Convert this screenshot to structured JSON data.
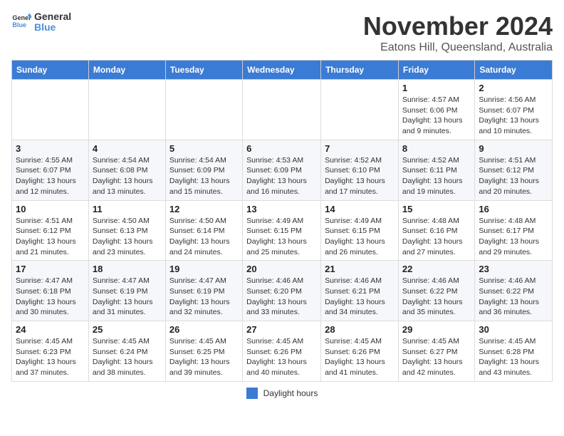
{
  "header": {
    "logo_line1": "General",
    "logo_line2": "Blue",
    "month": "November 2024",
    "location": "Eatons Hill, Queensland, Australia"
  },
  "days_of_week": [
    "Sunday",
    "Monday",
    "Tuesday",
    "Wednesday",
    "Thursday",
    "Friday",
    "Saturday"
  ],
  "weeks": [
    [
      {
        "day": "",
        "info": ""
      },
      {
        "day": "",
        "info": ""
      },
      {
        "day": "",
        "info": ""
      },
      {
        "day": "",
        "info": ""
      },
      {
        "day": "",
        "info": ""
      },
      {
        "day": "1",
        "info": "Sunrise: 4:57 AM\nSunset: 6:06 PM\nDaylight: 13 hours and 9 minutes."
      },
      {
        "day": "2",
        "info": "Sunrise: 4:56 AM\nSunset: 6:07 PM\nDaylight: 13 hours and 10 minutes."
      }
    ],
    [
      {
        "day": "3",
        "info": "Sunrise: 4:55 AM\nSunset: 6:07 PM\nDaylight: 13 hours and 12 minutes."
      },
      {
        "day": "4",
        "info": "Sunrise: 4:54 AM\nSunset: 6:08 PM\nDaylight: 13 hours and 13 minutes."
      },
      {
        "day": "5",
        "info": "Sunrise: 4:54 AM\nSunset: 6:09 PM\nDaylight: 13 hours and 15 minutes."
      },
      {
        "day": "6",
        "info": "Sunrise: 4:53 AM\nSunset: 6:09 PM\nDaylight: 13 hours and 16 minutes."
      },
      {
        "day": "7",
        "info": "Sunrise: 4:52 AM\nSunset: 6:10 PM\nDaylight: 13 hours and 17 minutes."
      },
      {
        "day": "8",
        "info": "Sunrise: 4:52 AM\nSunset: 6:11 PM\nDaylight: 13 hours and 19 minutes."
      },
      {
        "day": "9",
        "info": "Sunrise: 4:51 AM\nSunset: 6:12 PM\nDaylight: 13 hours and 20 minutes."
      }
    ],
    [
      {
        "day": "10",
        "info": "Sunrise: 4:51 AM\nSunset: 6:12 PM\nDaylight: 13 hours and 21 minutes."
      },
      {
        "day": "11",
        "info": "Sunrise: 4:50 AM\nSunset: 6:13 PM\nDaylight: 13 hours and 23 minutes."
      },
      {
        "day": "12",
        "info": "Sunrise: 4:50 AM\nSunset: 6:14 PM\nDaylight: 13 hours and 24 minutes."
      },
      {
        "day": "13",
        "info": "Sunrise: 4:49 AM\nSunset: 6:15 PM\nDaylight: 13 hours and 25 minutes."
      },
      {
        "day": "14",
        "info": "Sunrise: 4:49 AM\nSunset: 6:15 PM\nDaylight: 13 hours and 26 minutes."
      },
      {
        "day": "15",
        "info": "Sunrise: 4:48 AM\nSunset: 6:16 PM\nDaylight: 13 hours and 27 minutes."
      },
      {
        "day": "16",
        "info": "Sunrise: 4:48 AM\nSunset: 6:17 PM\nDaylight: 13 hours and 29 minutes."
      }
    ],
    [
      {
        "day": "17",
        "info": "Sunrise: 4:47 AM\nSunset: 6:18 PM\nDaylight: 13 hours and 30 minutes."
      },
      {
        "day": "18",
        "info": "Sunrise: 4:47 AM\nSunset: 6:19 PM\nDaylight: 13 hours and 31 minutes."
      },
      {
        "day": "19",
        "info": "Sunrise: 4:47 AM\nSunset: 6:19 PM\nDaylight: 13 hours and 32 minutes."
      },
      {
        "day": "20",
        "info": "Sunrise: 4:46 AM\nSunset: 6:20 PM\nDaylight: 13 hours and 33 minutes."
      },
      {
        "day": "21",
        "info": "Sunrise: 4:46 AM\nSunset: 6:21 PM\nDaylight: 13 hours and 34 minutes."
      },
      {
        "day": "22",
        "info": "Sunrise: 4:46 AM\nSunset: 6:22 PM\nDaylight: 13 hours and 35 minutes."
      },
      {
        "day": "23",
        "info": "Sunrise: 4:46 AM\nSunset: 6:22 PM\nDaylight: 13 hours and 36 minutes."
      }
    ],
    [
      {
        "day": "24",
        "info": "Sunrise: 4:45 AM\nSunset: 6:23 PM\nDaylight: 13 hours and 37 minutes."
      },
      {
        "day": "25",
        "info": "Sunrise: 4:45 AM\nSunset: 6:24 PM\nDaylight: 13 hours and 38 minutes."
      },
      {
        "day": "26",
        "info": "Sunrise: 4:45 AM\nSunset: 6:25 PM\nDaylight: 13 hours and 39 minutes."
      },
      {
        "day": "27",
        "info": "Sunrise: 4:45 AM\nSunset: 6:26 PM\nDaylight: 13 hours and 40 minutes."
      },
      {
        "day": "28",
        "info": "Sunrise: 4:45 AM\nSunset: 6:26 PM\nDaylight: 13 hours and 41 minutes."
      },
      {
        "day": "29",
        "info": "Sunrise: 4:45 AM\nSunset: 6:27 PM\nDaylight: 13 hours and 42 minutes."
      },
      {
        "day": "30",
        "info": "Sunrise: 4:45 AM\nSunset: 6:28 PM\nDaylight: 13 hours and 43 minutes."
      }
    ]
  ],
  "footer": {
    "legend_label": "Daylight hours"
  }
}
